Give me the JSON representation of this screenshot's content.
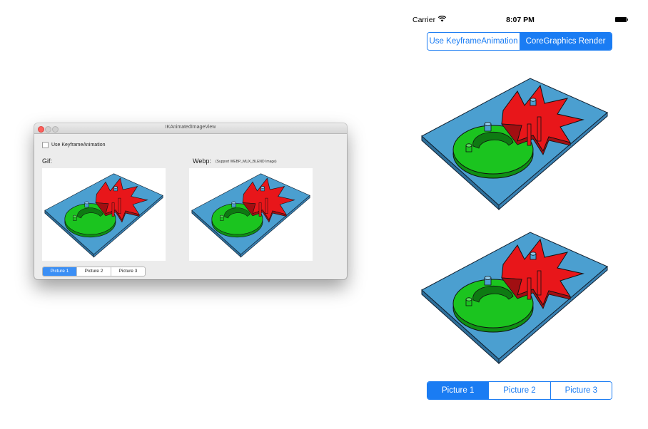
{
  "mac_window": {
    "title": "IKAnimatedImageView",
    "checkbox_label": "Use KeyframeAnimation",
    "checkbox_checked": false,
    "gif_label": "Gif:",
    "webp_label": "Webp:",
    "webp_note": "(Support WEBP_MUX_BLEND Image)",
    "segments": [
      "Picture 1",
      "Picture 2",
      "Picture 3"
    ],
    "selected_segment": "Picture 1"
  },
  "ios": {
    "status": {
      "carrier": "Carrier",
      "time": "8:07 PM",
      "wifi_icon": "wifi-icon",
      "battery_icon": "battery-icon"
    },
    "top_segments": [
      "Use KeyframeAnimation",
      "CoreGraphics Render"
    ],
    "top_selected": "CoreGraphics Render",
    "bottom_segments": [
      "Picture 1",
      "Picture 2",
      "Picture 3"
    ],
    "bottom_selected": "Picture 1"
  },
  "colors": {
    "accent": "#1a7cf3",
    "mac_accent": "#3b8ff5",
    "plate": "#4b9fd0",
    "disc": "#1bc41f",
    "star": "#e8161a"
  }
}
